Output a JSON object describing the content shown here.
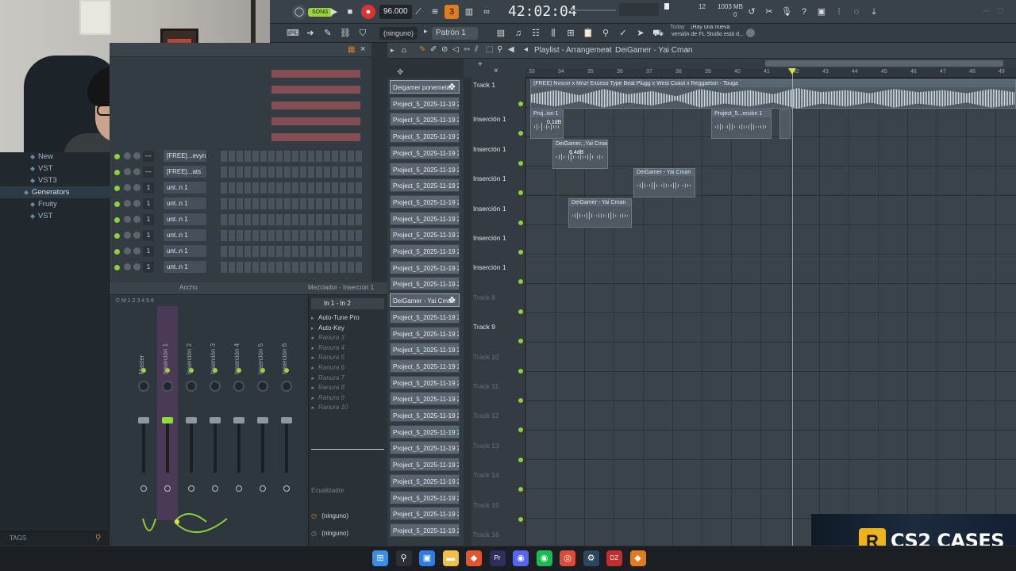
{
  "toolbar": {
    "song_label": "SONG",
    "tempo": "96.000",
    "time": "42:02:04",
    "cpu_value": "12",
    "ram_value": "1003 MB",
    "ram_sub": "0",
    "hint_day": "Today",
    "hint_line1": "¡Hay una nueva",
    "hint_line2": "versión de FL Studio está d..."
  },
  "toolbar2": {
    "snap": "(ninguno)",
    "pattern": "Patrón 1"
  },
  "browser": {
    "items": [
      {
        "label": "New",
        "level": 2
      },
      {
        "label": "VST",
        "level": 2
      },
      {
        "label": "VST3",
        "level": 2
      },
      {
        "label": "Generators",
        "level": 1
      },
      {
        "label": "Fruity",
        "level": 2
      },
      {
        "label": "VST",
        "level": 2
      }
    ],
    "tags_label": "TAGS"
  },
  "rack": {
    "channels": [
      {
        "num": "—",
        "name": "[FREE]...evyn2"
      },
      {
        "num": "—",
        "name": "[FREE]...ats"
      },
      {
        "num": "1",
        "name": "unt..n 1"
      },
      {
        "num": "1",
        "name": "unt..n 1"
      },
      {
        "num": "1",
        "name": "unt..n 1"
      },
      {
        "num": "1",
        "name": "unt..n 1"
      },
      {
        "num": "1",
        "name": "unt..n 1"
      },
      {
        "num": "1",
        "name": "unt..n 1"
      }
    ]
  },
  "mixer": {
    "title": "Mezclador - Inserción 1",
    "width_label": "Ancho",
    "strips": [
      "Master",
      "Inserción 1",
      "Inserción 2",
      "Inserción 3",
      "Inserción 4",
      "Inserción 5",
      "Inserción 6"
    ],
    "strip_nums": [
      "C",
      "M",
      "1",
      "2",
      "3",
      "4",
      "5",
      "6"
    ],
    "route": "In 1 - In 2",
    "slots": [
      {
        "label": "Auto-Tune Pro",
        "dim": false
      },
      {
        "label": "Auto-Key",
        "dim": false
      },
      {
        "label": "Ranura 3",
        "dim": true
      },
      {
        "label": "Ranura 4",
        "dim": true
      },
      {
        "label": "Ranura 5",
        "dim": true
      },
      {
        "label": "Ranura 6",
        "dim": true
      },
      {
        "label": "Ranura 7",
        "dim": true
      },
      {
        "label": "Ranura 8",
        "dim": true
      },
      {
        "label": "Ranura 9",
        "dim": true
      },
      {
        "label": "Ranura 10",
        "dim": true
      }
    ],
    "eq_label": "Ecualizador",
    "send1": "(ninguno)",
    "send2": "(ninguno)"
  },
  "playlist": {
    "breadcrumb": "Playlist - Arrangement",
    "breadcrumb_sep": "›",
    "current": "DeiGamer - Yai Cman",
    "ruler": [
      "33",
      "34",
      "35",
      "36",
      "37",
      "38",
      "39",
      "40",
      "41",
      "42",
      "43",
      "44",
      "45",
      "46",
      "47",
      "48",
      "49"
    ],
    "patterns": [
      "Deigamer ponemela...",
      "Project_5_2025-11-19 2...",
      "Project_5_2025-11-19 2...",
      "Project_5_2025-11-19 2...",
      "Project_5_2025-11-19 2...",
      "Project_5_2025-11-19 2...",
      "Project_5_2025-11-19 2...",
      "Project_5_2025-11-19 2...",
      "Project_5_2025-11-19 2...",
      "Project_5_2025-11-19 2...",
      "Project_5_2025-11-19 2...",
      "Project_5_2025-11-19 2...",
      "Project_5_2025-11-19 2...",
      "DeiGamer - Yai Cman",
      "Project_5_2025-11-19 2...",
      "Project_5_2025-11-19 2...",
      "Project_5_2025-11-19 2...",
      "Project_5_2025-11-19 2...",
      "Project_5_2025-11-19 2...",
      "Project_5_2025-11-19 2...",
      "Project_5_2025-11-19 2...",
      "Project_5_2025-11-19 2...",
      "Project_5_2025-11-19 2...",
      "Project_5_2025-11-19 2...",
      "Project_5_2025-11-19 2...",
      "Project_5_2025-11-19 2...",
      "Project_5_2025-11-19 2...",
      "Project_5_2025-11-19 2..."
    ],
    "tracks": [
      {
        "label": "Track 1",
        "dim": false
      },
      {
        "label": "Inserción 1",
        "dim": false
      },
      {
        "label": "Inserción 1",
        "dim": false
      },
      {
        "label": "Inserción 1",
        "dim": false
      },
      {
        "label": "Inserción 1",
        "dim": false
      },
      {
        "label": "Inserción 1",
        "dim": false
      },
      {
        "label": "Inserción 1",
        "dim": false
      },
      {
        "label": "Track 8",
        "dim": true
      },
      {
        "label": "Track 9",
        "dim": false
      },
      {
        "label": "Track 10",
        "dim": true
      },
      {
        "label": "Track 11",
        "dim": true
      },
      {
        "label": "Track 12",
        "dim": true
      },
      {
        "label": "Track 13",
        "dim": true
      },
      {
        "label": "Track 14",
        "dim": true
      },
      {
        "label": "Track 15",
        "dim": true
      },
      {
        "label": "Track 16",
        "dim": true
      }
    ],
    "big_clip": "(FREE) Nvscvr x Mnzr Exceso Type Beat  Plugg x West Coast x Reggaeton - Touga",
    "clips": [
      {
        "name": "Proj..ion 1",
        "gain": "0.1dB"
      },
      {
        "name": "Project_5...erción 1",
        "gain": ""
      },
      {
        "name": "DeiGamer...Yai Cman",
        "gain": "6.4dB"
      },
      {
        "name": "DeiGamer - Yai Cman",
        "gain": ""
      },
      {
        "name": "DeiGamer - Yai Cman",
        "gain": ""
      }
    ]
  },
  "overlay": {
    "cs2_logo": "R",
    "cs2_text": "CS2 CASES"
  },
  "taskbar": {
    "icons": [
      "windows-start-icon",
      "search-icon",
      "widgets-icon",
      "file-explorer-icon",
      "brave-browser-icon",
      "premiere-icon",
      "discord-icon",
      "spotify-icon",
      "chrome-icon",
      "steam-icon",
      "dzl-app-icon",
      "fl-studio-icon"
    ]
  }
}
